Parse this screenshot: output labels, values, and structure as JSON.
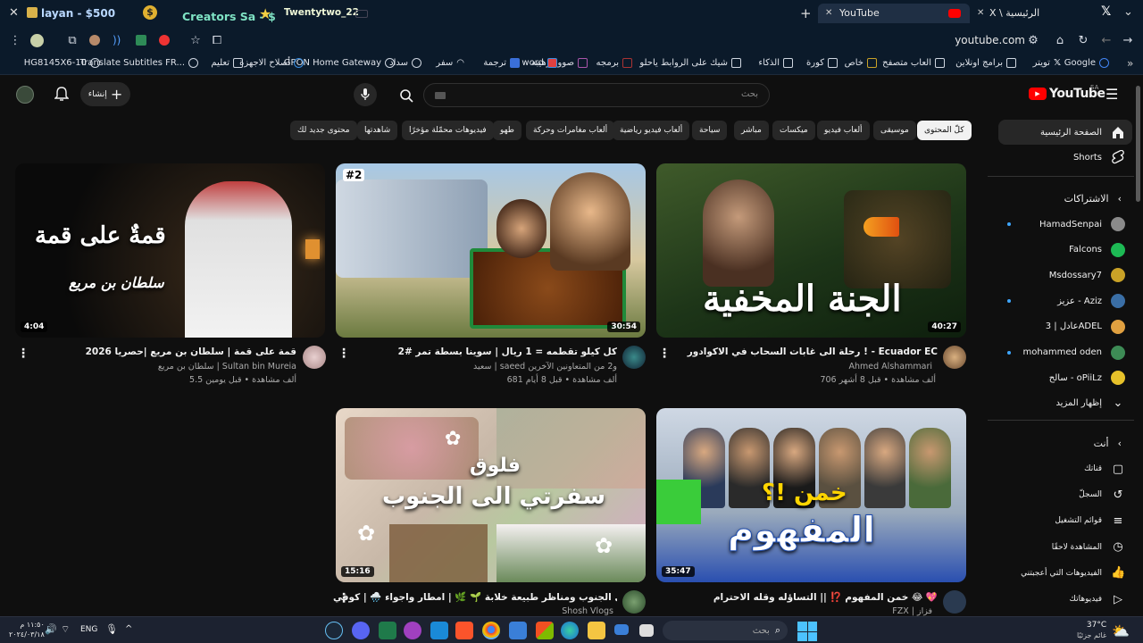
{
  "titlebar": {
    "stream_text_1": "layan - $500",
    "stream_text_2": "Creators Sa - $",
    "stream_text_3": "Twentytwo_22",
    "tabs": [
      {
        "label": "YouTube"
      },
      {
        "label": "X \\ الرئيسية"
      }
    ]
  },
  "address": {
    "url": "youtube.com"
  },
  "bookmarks": [
    {
      "label": "Google"
    },
    {
      "label": "تويتر"
    },
    {
      "label": "برامج اونلاين"
    },
    {
      "label": "العاب متصفح"
    },
    {
      "label": "خاص"
    },
    {
      "label": "كورة"
    },
    {
      "label": "الذكاء"
    },
    {
      "label": "شيك على الروابط ياحلو"
    },
    {
      "label": "برمجه"
    },
    {
      "label": "صوور رهيبه"
    },
    {
      "label": "word"
    },
    {
      "label": "ترجمة"
    },
    {
      "label": "سفر"
    },
    {
      "label": "سداد"
    },
    {
      "label": "GPON Home Gateway"
    },
    {
      "label": "أصلاح الاجهزة"
    },
    {
      "label": "تعليم"
    },
    {
      "label": "Translate Subtitles FR..."
    },
    {
      "label": "HG8145X6-10"
    }
  ],
  "yt_header": {
    "logo": "YouTube",
    "region": "SA",
    "search_placeholder": "بحث",
    "create_label": "إنشاء"
  },
  "chips": [
    {
      "label": "كلّ المحتوى",
      "active": true
    },
    {
      "label": "موسيقى"
    },
    {
      "label": "ألعاب فيديو"
    },
    {
      "label": "ميكسات"
    },
    {
      "label": "مباشر"
    },
    {
      "label": "سياحة"
    },
    {
      "label": "ألعاب فيديو رياضية"
    },
    {
      "label": "ألعاب مغامرات وحركة"
    },
    {
      "label": "طهو"
    },
    {
      "label": "فيديوهات محمّلة مؤخرًا"
    },
    {
      "label": "شاهدتها"
    },
    {
      "label": "محتوى جديد لك"
    }
  ],
  "sidebar": {
    "home": "الصفحة الرئيسية",
    "shorts": "Shorts",
    "subscriptions_heading": "الاشتراكات",
    "subscriptions": [
      {
        "name": "HamadSenpai",
        "color": "#8a8a8a"
      },
      {
        "name": "Falcons",
        "color": "#1db954"
      },
      {
        "name": "Msdossary7",
        "color": "#c9a227"
      },
      {
        "name": "عزيز - Aziz",
        "color": "#3a6ea5"
      },
      {
        "name": "عادل | 3ADEL",
        "color": "#e0a040"
      },
      {
        "name": "mohammed oden",
        "color": "#3d8b55"
      },
      {
        "name": "سالح - oPiiLz",
        "color": "#e6c12a"
      }
    ],
    "show_more": "إظهار المزيد",
    "you_heading": "أنت",
    "you_items": [
      {
        "label": "قناتك"
      },
      {
        "label": "السجلّ"
      },
      {
        "label": "قوائم التشغيل"
      },
      {
        "label": "المشاهدة لاحقًا"
      },
      {
        "label": "الفيديوهات التي أعجبتني"
      },
      {
        "label": "فيديوهاتك"
      }
    ]
  },
  "videos": [
    {
      "title": "رحلة الى غابات السحاب في الاكوادور ! - Ecuador EC",
      "channel": "Ahmed Alshammari",
      "meta": "706 ألف مشاهدة • قبل 8 أشهر",
      "duration": "40:27",
      "thumb_text": "الجنة المخفية"
    },
    {
      "title": "كل كيلو تقطمه = 1 ريال | سوينا بسطة تمر #2",
      "channel": "سعيد | saeed و2 من المتعاونين الآخرين",
      "meta": "681 ألف مشاهدة • قبل 8 أيام",
      "duration": "30:54",
      "thumb_text": "#2"
    },
    {
      "title": "قمة على قمة | سلطان بن مريع |حصريا 2026",
      "channel": "سلطان بن مريع | Sultan bin Mureia",
      "meta": "5.5 ألف مشاهدة • قبل يومين",
      "duration": "4:04",
      "thumb_text": "قمةٌ على قمة",
      "thumb_sub": "سلطان بن مريع"
    },
    {
      "title": "خمن المفهوم ⁉️ || التساؤله وقله الاحترام 😂 💖",
      "channel": "FZX | فزاز",
      "meta": "",
      "duration": "35:47",
      "thumb_text": "خمن !؟",
      "thumb_text2": "المفهوم"
    },
    {
      "title": "سفرتي الى الجنوب ومناظر طبيعة خلابة 🌱 🌿 | امطار واجواء 🌧️ | كوفي 🍥",
      "channel": "Shosh Vlogs",
      "meta": "",
      "duration": "15:16",
      "thumb_text": "فلوق",
      "thumb_text2": "سفرتي الى الجنوب"
    }
  ],
  "taskbar": {
    "search_placeholder": "بحث",
    "weather_temp": "37°C",
    "weather_desc": "غائم جزئيًا",
    "lang": "ENG",
    "time": "١١:٥٠ م",
    "date": "٢٠٢٤/٠٣/١٨"
  }
}
